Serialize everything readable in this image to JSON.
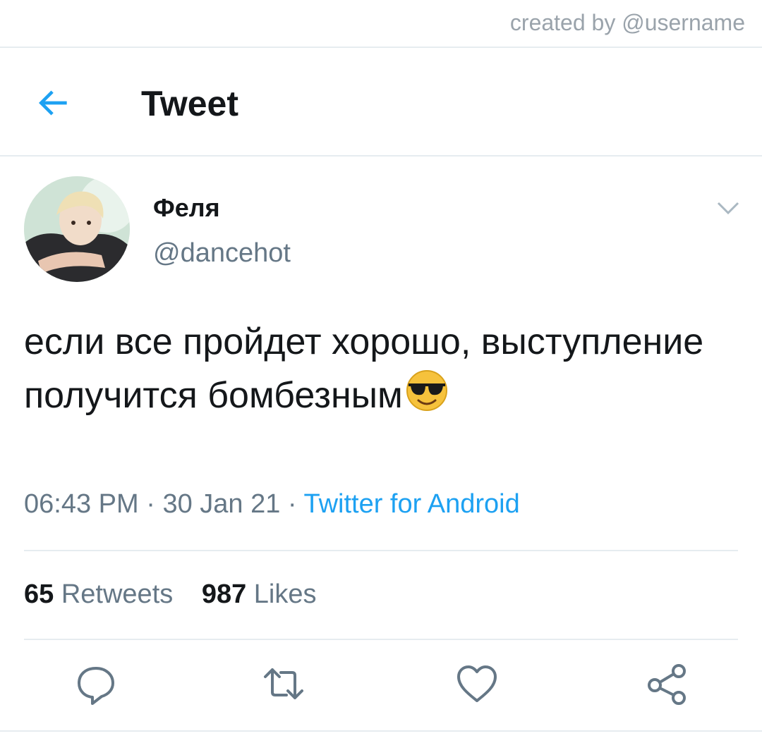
{
  "watermark": "created by @username",
  "header": {
    "title": "Tweet",
    "back_icon": "arrow-left-icon"
  },
  "tweet": {
    "display_name": "Феля",
    "handle": "@dancehot",
    "text": "если все пройдет хорошо, выступление получится бомбезным",
    "emoji": "smiling-face-with-sunglasses",
    "time": "06:43 PM",
    "dot1": " · ",
    "date": "30 Jan 21",
    "dot2": " · ",
    "source": "Twitter for Android"
  },
  "stats": {
    "retweets_count": "65",
    "retweets_label": "Retweets",
    "likes_count": "987",
    "likes_label": "Likes"
  },
  "actions": [
    "reply-icon",
    "retweet-icon",
    "like-icon",
    "share-icon"
  ],
  "colors": {
    "accent": "#1da1f2",
    "secondary_text": "#657786",
    "divider": "#e6ecf0"
  }
}
